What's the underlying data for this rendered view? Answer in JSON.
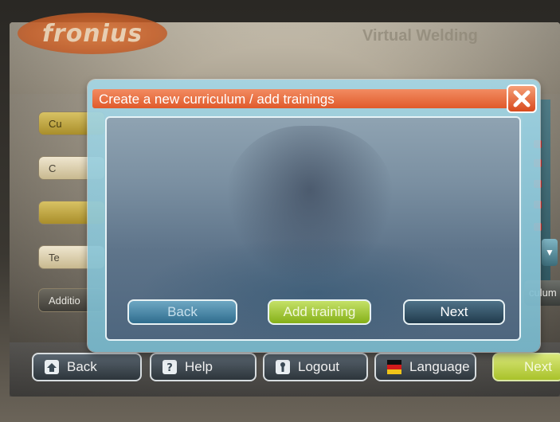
{
  "background": {
    "brand_logo_text": "fronius",
    "top_title": "Virtual Welding",
    "side_buttons": [
      "Cu",
      "C",
      "",
      "Te",
      "Additio"
    ],
    "right_curriculum_label": "culum",
    "right_scroll_glyph": "▼"
  },
  "dialog": {
    "title": "Create a new curriculum / add trainings",
    "close_icon": "close-icon",
    "buttons": {
      "back": "Back",
      "add_training": "Add training",
      "next": "Next"
    }
  },
  "bottom_bar": {
    "back": "Back",
    "help": "Help",
    "logout": "Logout",
    "language": "Language",
    "next": "Next"
  },
  "colors": {
    "title_bar": "#e05a2b",
    "add_training": "#85b018",
    "dialog_frame": "#a5d7e6"
  }
}
